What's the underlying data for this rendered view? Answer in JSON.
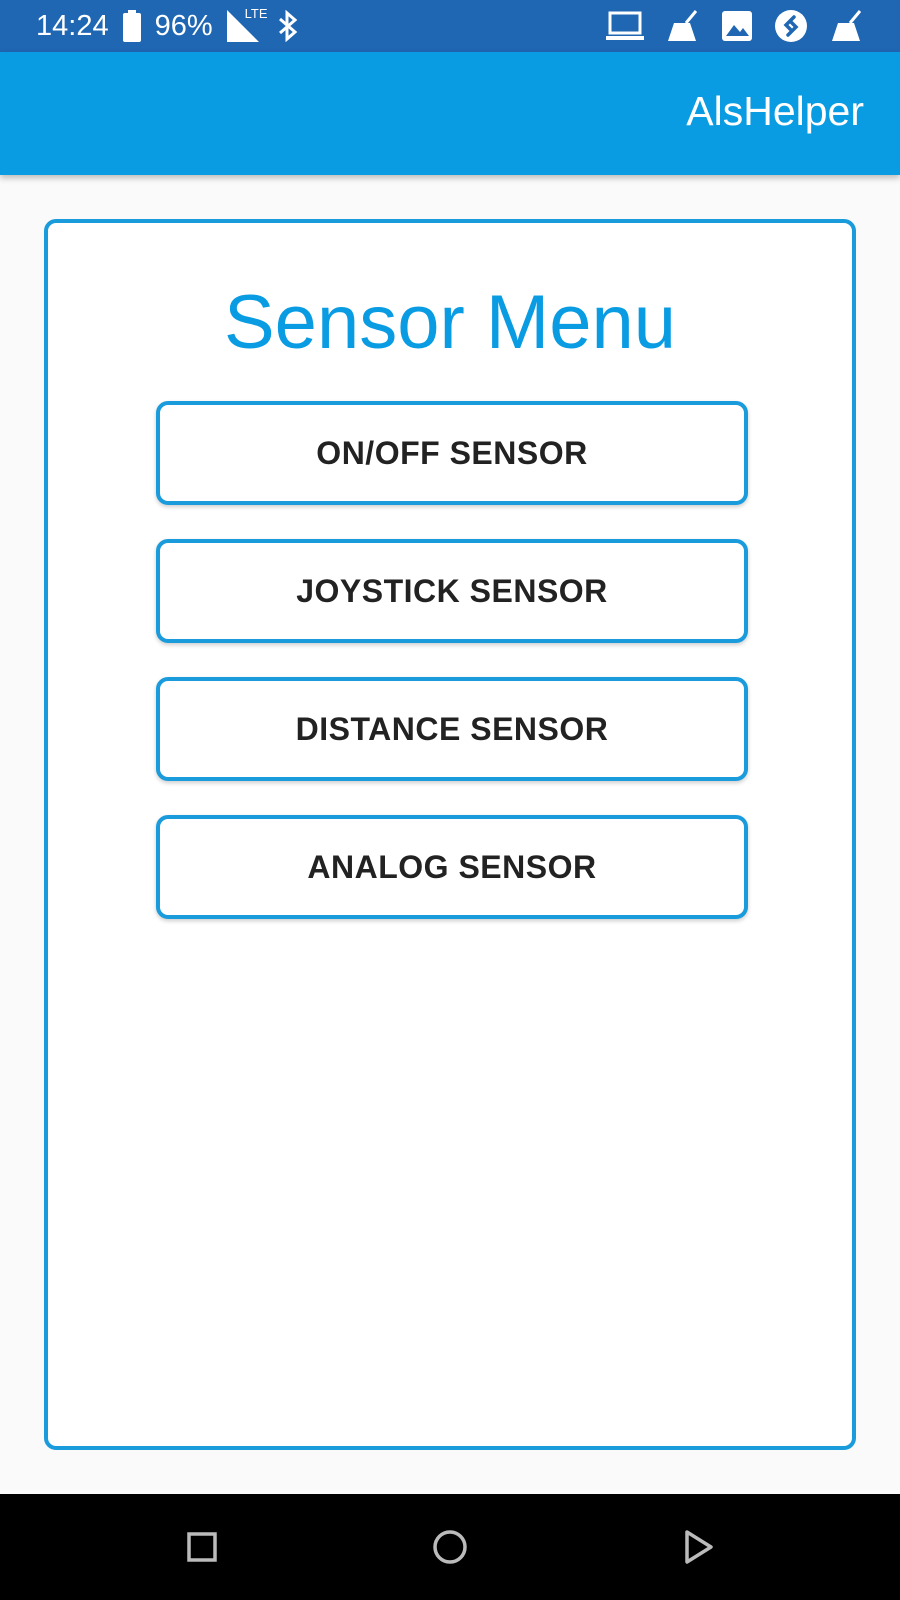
{
  "status_bar": {
    "time": "14:24",
    "battery": "96%",
    "left_icons": [
      "battery-icon",
      "signal-lte-icon",
      "bluetooth-icon"
    ],
    "right_icons": [
      "laptop-icon",
      "broom-icon",
      "image-icon",
      "shazam-icon",
      "broom-icon"
    ],
    "lte_label": "LTE"
  },
  "app_bar": {
    "title": "AlsHelper"
  },
  "card": {
    "title": "Sensor Menu",
    "buttons": [
      {
        "label": "ON/OFF SENSOR"
      },
      {
        "label": "JOYSTICK SENSOR"
      },
      {
        "label": "DISTANCE SENSOR"
      },
      {
        "label": "ANALOG SENSOR"
      }
    ]
  },
  "nav_bar": {
    "icons": [
      "recents-icon",
      "home-icon",
      "back-icon"
    ]
  },
  "colors": {
    "status_bar": "#1f66b3",
    "app_bar": "#0a9ce3",
    "accent": "#1a9bdc",
    "title_text": "#0a9ce3"
  }
}
